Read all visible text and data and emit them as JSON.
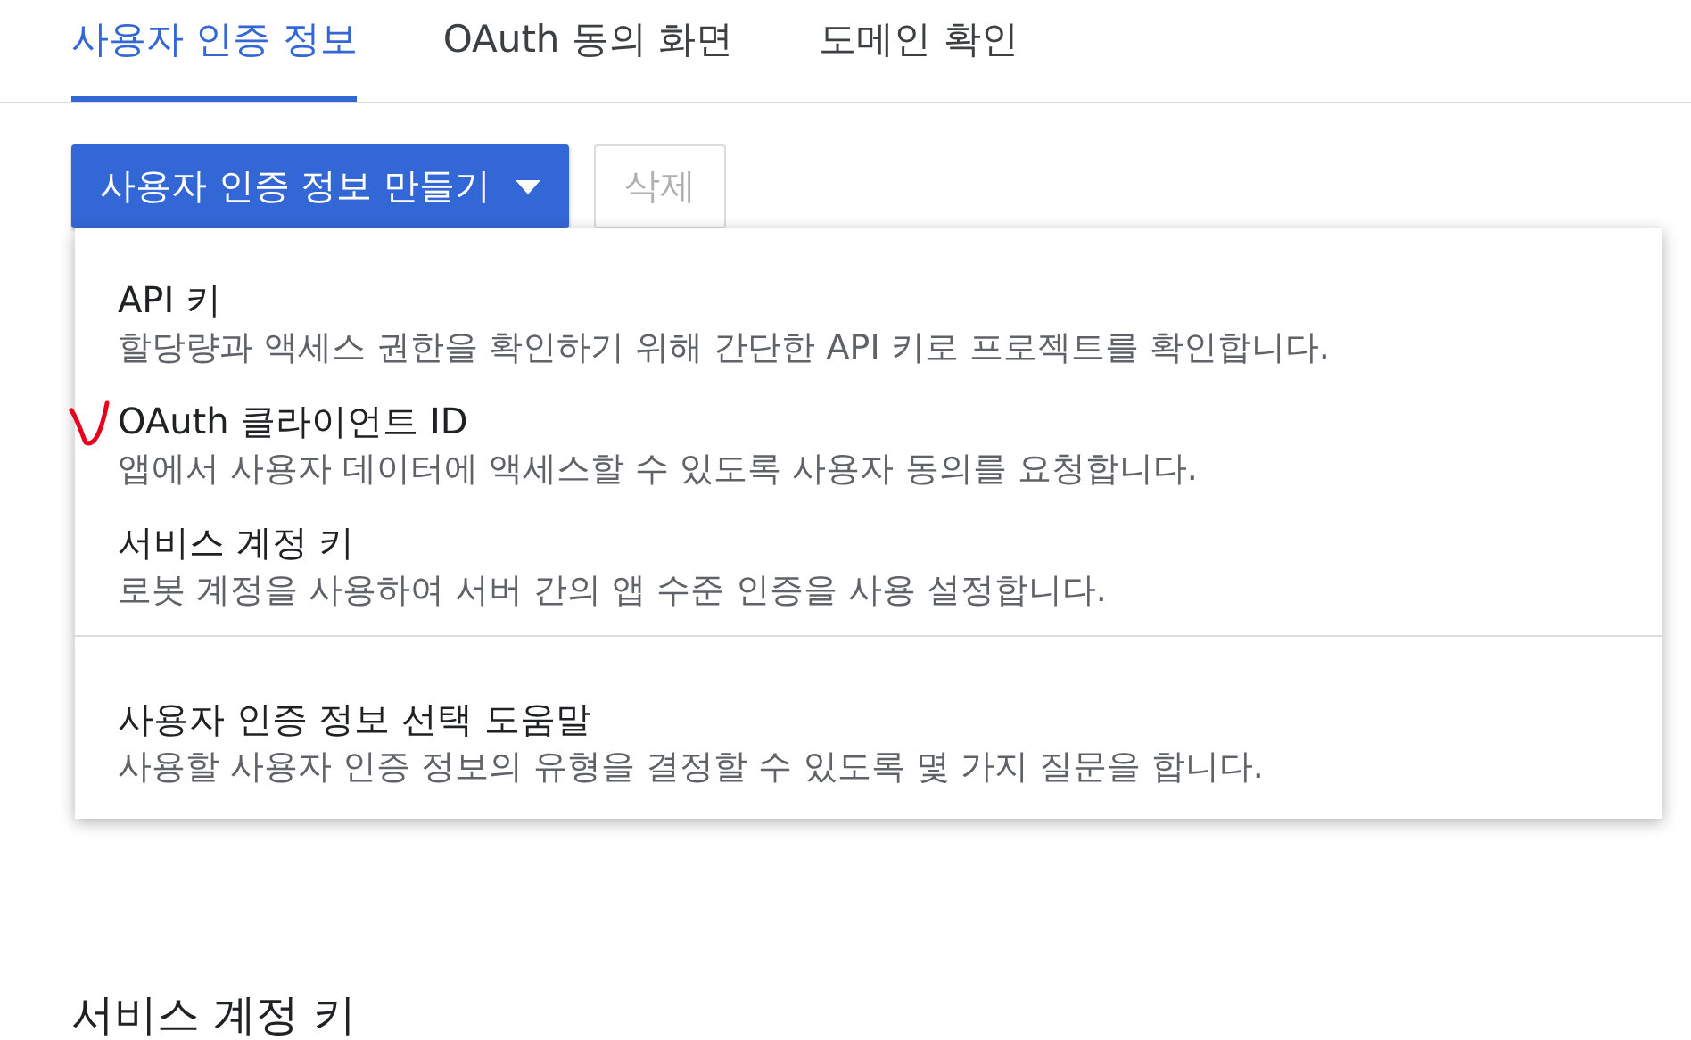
{
  "tabs": [
    {
      "label": "사용자 인증 정보",
      "selected": true
    },
    {
      "label": "OAuth 동의 화면",
      "selected": false
    },
    {
      "label": "도메인 확인",
      "selected": false
    }
  ],
  "toolbar": {
    "create_button": "사용자 인증 정보 만들기",
    "delete_button": {
      "label": "삭제",
      "disabled": true
    }
  },
  "menu": {
    "sections": [
      {
        "items": [
          {
            "title": "API 키",
            "description": "할당량과 액세스 권한을 확인하기 위해 간단한 API 키로 프로젝트를 확인합니다.",
            "marked": false
          },
          {
            "title": "OAuth 클라이언트 ID",
            "description": "앱에서 사용자 데이터에 액세스할 수 있도록 사용자 동의를 요청합니다.",
            "marked": true
          },
          {
            "title": "서비스 계정 키",
            "description": "로봇 계정을 사용하여 서버 간의 앱 수준 인증을 사용 설정합니다.",
            "marked": false
          }
        ]
      },
      {
        "items": [
          {
            "title": "사용자 인증 정보 선택 도움말",
            "description": "사용할 사용자 인증 정보의 유형을 결정할 수 있도록 몇 가지 질문을 합니다.",
            "marked": false
          }
        ]
      }
    ]
  },
  "section_heading": "서비스 계정 키"
}
